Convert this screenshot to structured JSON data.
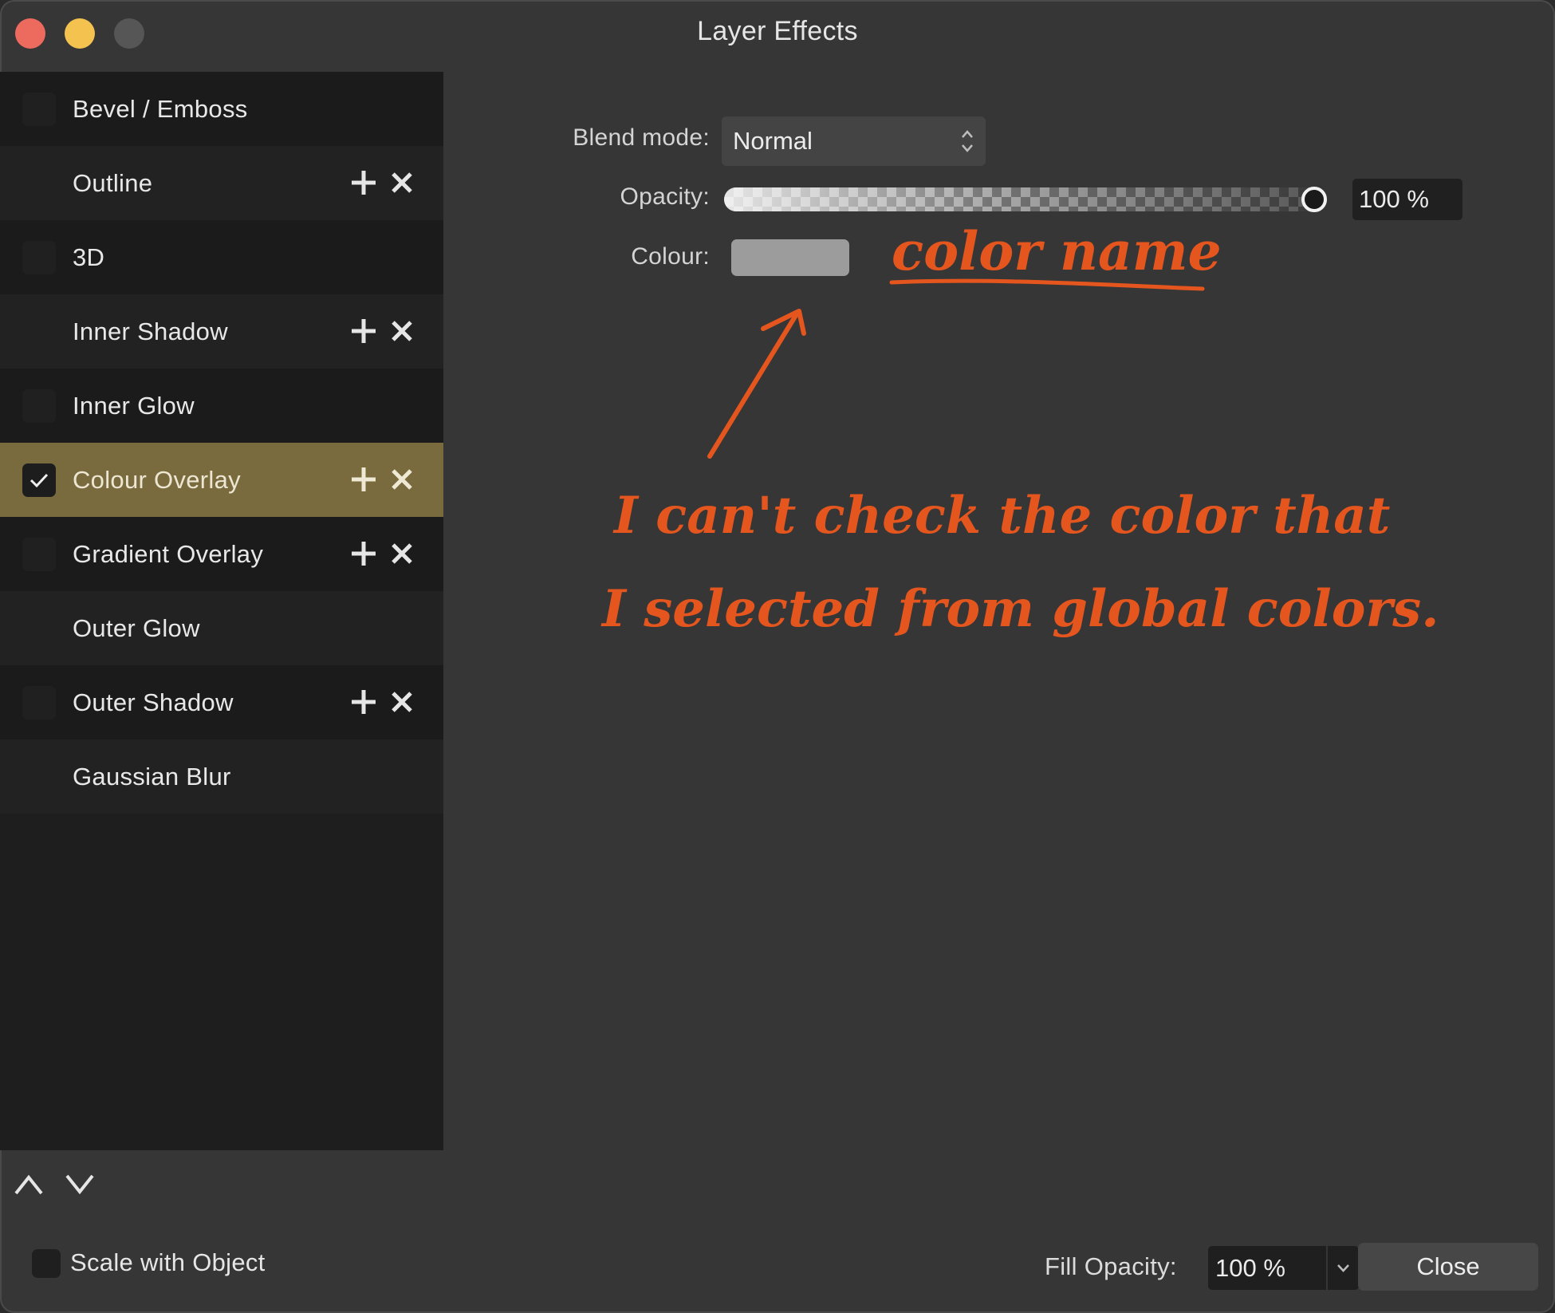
{
  "window": {
    "title": "Layer Effects"
  },
  "effects": [
    {
      "label": "Bevel / Emboss",
      "checked": false,
      "has_actions": false
    },
    {
      "label": "Outline",
      "checked": false,
      "has_actions": true
    },
    {
      "label": "3D",
      "checked": false,
      "has_actions": false
    },
    {
      "label": "Inner Shadow",
      "checked": false,
      "has_actions": true
    },
    {
      "label": "Inner Glow",
      "checked": false,
      "has_actions": false
    },
    {
      "label": "Colour Overlay",
      "checked": true,
      "has_actions": true,
      "selected": true
    },
    {
      "label": "Gradient Overlay",
      "checked": false,
      "has_actions": true
    },
    {
      "label": "Outer Glow",
      "checked": false,
      "has_actions": false
    },
    {
      "label": "Outer Shadow",
      "checked": false,
      "has_actions": true
    },
    {
      "label": "Gaussian Blur",
      "checked": false,
      "has_actions": false
    }
  ],
  "settings": {
    "blend_mode_label": "Blend mode:",
    "blend_mode_value": "Normal",
    "opacity_label": "Opacity:",
    "opacity_value": "100 %",
    "opacity_fraction": 1.0,
    "colour_label": "Colour:",
    "colour_swatch": "#9c9c9c"
  },
  "annotations": {
    "color_name": "color name",
    "note_line1": "I can't check the color that",
    "note_line2": "I selected from global colors.",
    "ink_color": "#e5561e"
  },
  "footer": {
    "scale_label": "Scale with Object",
    "fill_opacity_label": "Fill Opacity:",
    "fill_opacity_value": "100 %",
    "close_label": "Close"
  },
  "colors": {
    "selected_row": "#7a6b3f",
    "panel": "#363636",
    "sidebar": "#1e1e1e"
  }
}
